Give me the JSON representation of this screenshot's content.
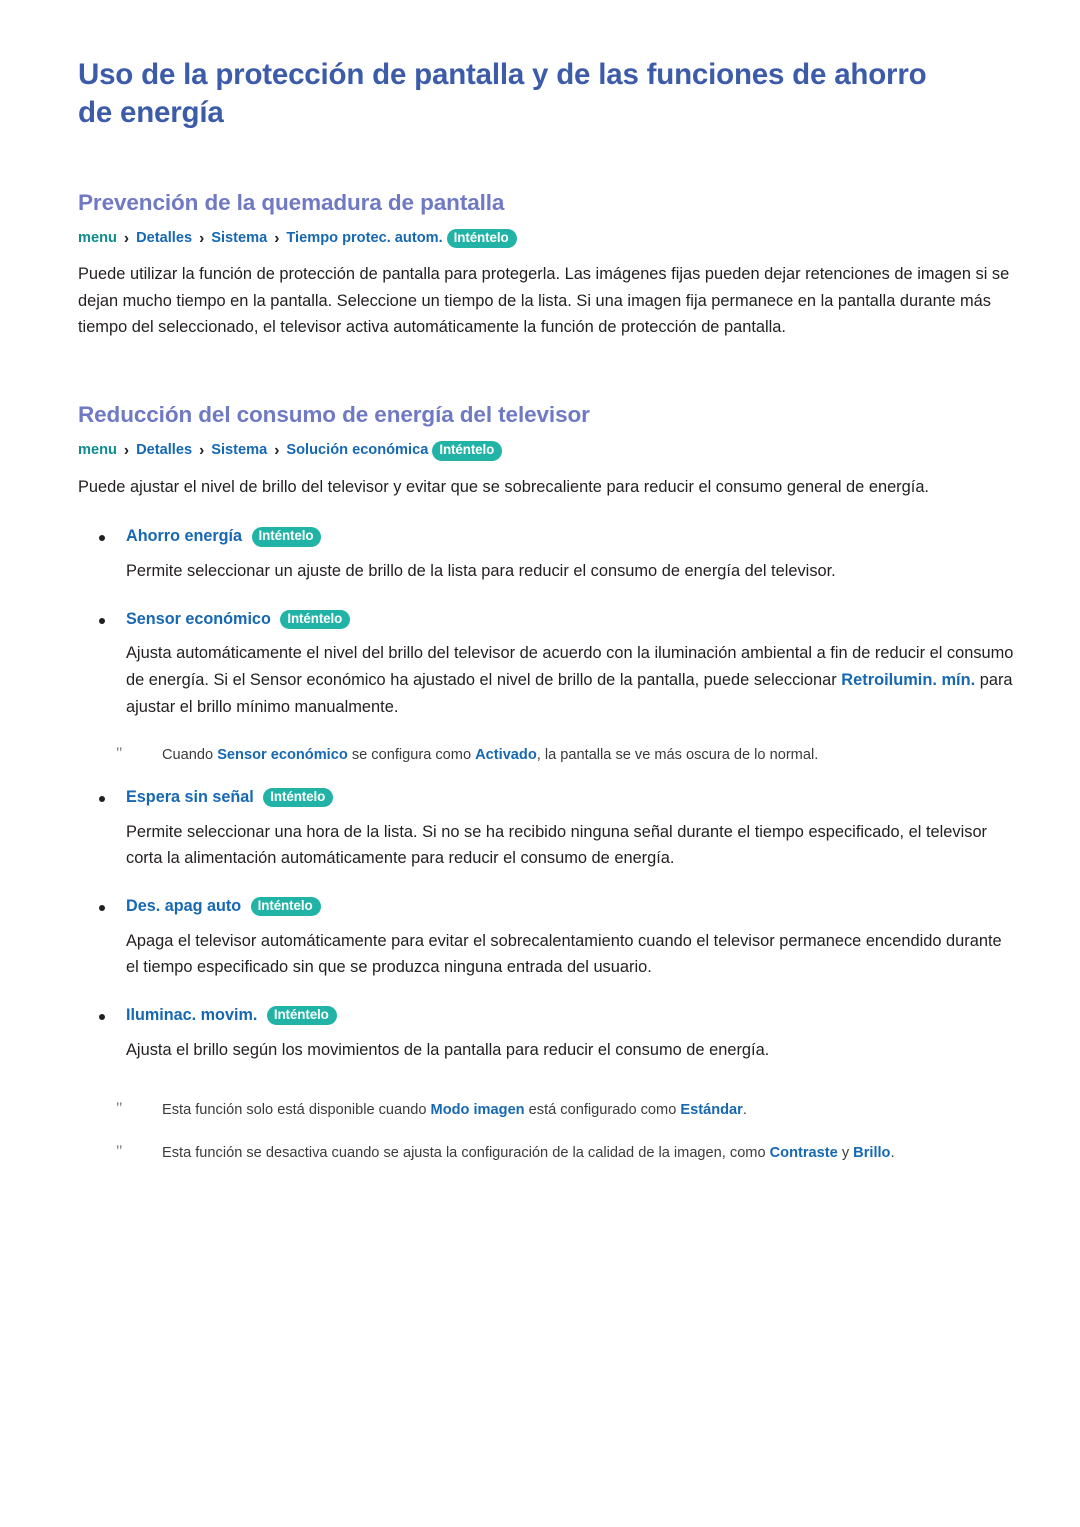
{
  "page": {
    "title": "Uso de la protección de pantalla y de las funciones de ahorro de energía"
  },
  "colors": {
    "title_blue": "#3c5ba9",
    "heading_purple": "#6f79c4",
    "link_blue": "#1668b3",
    "crumb_teal": "#0f8d8d",
    "pill_teal": "#21b3a6",
    "body_text": "#231f20"
  },
  "common": {
    "try_it_label": "Inténtelo",
    "separator": "›",
    "quote_mark": "\""
  },
  "sections": [
    {
      "heading": "Prevención de la quemadura de pantalla",
      "breadcrumb": {
        "root": "menu",
        "items": [
          "Detalles",
          "Sistema",
          "Tiempo protec. autom."
        ],
        "pill": "Inténtelo"
      },
      "paragraph": "Puede utilizar la función de protección de pantalla para protegerla. Las imágenes fijas pueden dejar retenciones de imagen si se dejan mucho tiempo en la pantalla. Seleccione un tiempo de la lista. Si una imagen fija permanece en la pantalla durante más tiempo del seleccionado, el televisor activa automáticamente la función de protección de pantalla."
    },
    {
      "heading": "Reducción del consumo de energía del televisor",
      "breadcrumb": {
        "root": "menu",
        "items": [
          "Detalles",
          "Sistema",
          "Solución económica"
        ],
        "pill": "Inténtelo"
      },
      "paragraph": "Puede ajustar el nivel de brillo del televisor y evitar que se sobrecaliente para reducir el consumo general de energía."
    }
  ],
  "bullets": [
    {
      "label": "Ahorro energía",
      "pill": "Inténtelo",
      "description": "Permite seleccionar un ajuste de brillo de la lista para reducir el consumo de energía del televisor.",
      "note": null
    },
    {
      "label": "Sensor económico",
      "pill": "Inténtelo",
      "description_parts": [
        {
          "text": "Ajusta automáticamente el nivel del brillo del televisor de acuerdo con la iluminación ambiental a fin de reducir el consumo de energía. Si el Sensor económico ha ajustado el nivel de brillo de la pantalla, puede seleccionar ",
          "bold": false
        },
        {
          "text": "Retroilumin. mín.",
          "bold": true
        },
        {
          "text": " para ajustar el brillo mínimo manualmente.",
          "bold": false
        }
      ],
      "note": {
        "mark": "\"",
        "parts": [
          {
            "text": "Cuando ",
            "bold": false
          },
          {
            "text": "Sensor económico",
            "bold": true
          },
          {
            "text": " se configura como ",
            "bold": false
          },
          {
            "text": "Activado",
            "bold": true
          },
          {
            "text": ", la pantalla se ve más oscura de lo normal.",
            "bold": false
          }
        ]
      }
    },
    {
      "label": "Espera sin señal",
      "pill": "Inténtelo",
      "description": "Permite seleccionar una hora de la lista. Si no se ha recibido ninguna señal durante el tiempo especificado, el televisor corta la alimentación automáticamente para reducir el consumo de energía.",
      "note": null
    },
    {
      "label": "Des. apag auto",
      "pill": "Inténtelo",
      "description": "Apaga el televisor automáticamente para evitar el sobrecalentamiento cuando el televisor permanece encendido durante el tiempo especificado sin que se produzca ninguna entrada del usuario.",
      "note": null
    },
    {
      "label": "Iluminac. movim.",
      "pill": "Inténtelo",
      "description": "Ajusta el brillo según los movimientos de la pantalla para reducir el consumo de energía.",
      "note": null
    }
  ],
  "footer_notes": [
    {
      "mark": "\"",
      "parts": [
        {
          "text": "Esta función solo está disponible cuando ",
          "bold": false
        },
        {
          "text": "Modo imagen",
          "bold": true
        },
        {
          "text": " está configurado como ",
          "bold": false
        },
        {
          "text": "Estándar",
          "bold": true
        },
        {
          "text": ".",
          "bold": false
        }
      ]
    },
    {
      "mark": "\"",
      "parts": [
        {
          "text": "Esta función se desactiva cuando se ajusta la configuración de la calidad de la imagen, como ",
          "bold": false
        },
        {
          "text": "Contraste",
          "bold": true
        },
        {
          "text": " y ",
          "bold": false
        },
        {
          "text": "Brillo",
          "bold": true
        },
        {
          "text": ".",
          "bold": false
        }
      ]
    }
  ]
}
